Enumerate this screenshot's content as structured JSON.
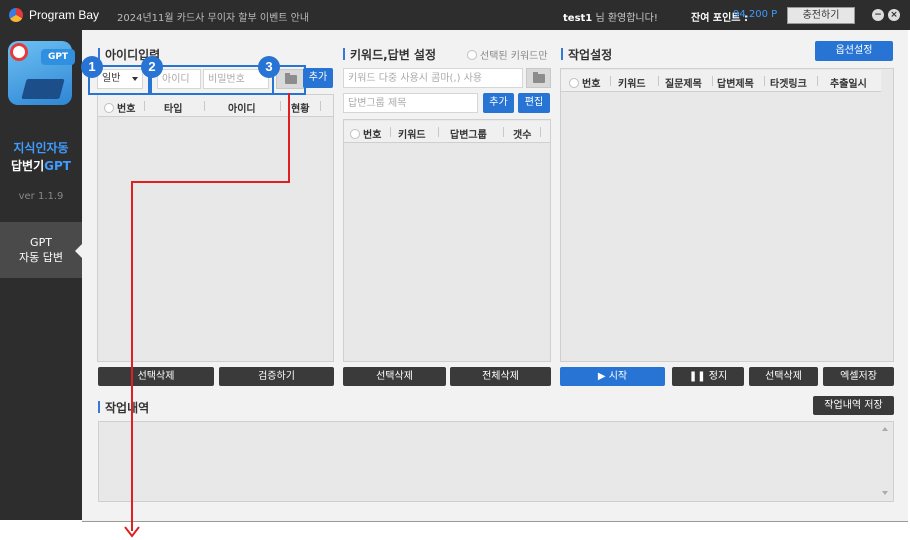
{
  "titlebar": {
    "app_name": "Program Bay",
    "notice": "2024년11월 카드사 무이자 할부 이벤트 안내",
    "user": "test1",
    "welcome_suffix": " 님 환영합니다!",
    "points_label": "잔여 포인트 :",
    "points_value": "94,200 P",
    "charge_button": "충전하기",
    "minimize": "−",
    "close": "×"
  },
  "sidebar": {
    "icon_badge": "GPT",
    "title_line1": "지식인자동",
    "title_line2_main": "답변기",
    "title_line2_accent": "GPT",
    "version": "ver 1.1.9",
    "menu_line1": "GPT",
    "menu_line2": "자동 답변"
  },
  "accounts": {
    "title": "아이디입력",
    "type_select": "일반",
    "id_placeholder": "아이디",
    "pw_placeholder": "비밀번호",
    "add_button": "추가",
    "headers": [
      "번호",
      "타입",
      "아이디",
      "현황"
    ],
    "delete_button": "선택삭제",
    "verify_button": "검증하기"
  },
  "keywords": {
    "title": "키워드,답변 설정",
    "selected_only": "선택된 키워드만",
    "keyword_placeholder": "키워드 다중 사용시 콤마(,) 사용",
    "group_placeholder": "답변그룹 제목",
    "add_button": "추가",
    "edit_button": "편집",
    "headers": [
      "번호",
      "키워드",
      "답변그룹",
      "갯수"
    ],
    "delete_button": "선택삭제",
    "delete_all_button": "전체삭제"
  },
  "tasks": {
    "title": "작업설정",
    "options_button": "옵션설정",
    "headers": [
      "번호",
      "키워드",
      "질문제목",
      "답변제목",
      "타겟링크",
      "추출일시"
    ],
    "start_button": "시작",
    "stop_button": "정지",
    "delete_button": "선택삭제",
    "excel_button": "엑셀저장"
  },
  "log": {
    "title": "작업내역",
    "save_button": "작업내역 저장"
  },
  "annotations": {
    "markers": [
      "1",
      "2",
      "3"
    ],
    "color": "#2874d4",
    "arrow_color": "#e02020"
  }
}
